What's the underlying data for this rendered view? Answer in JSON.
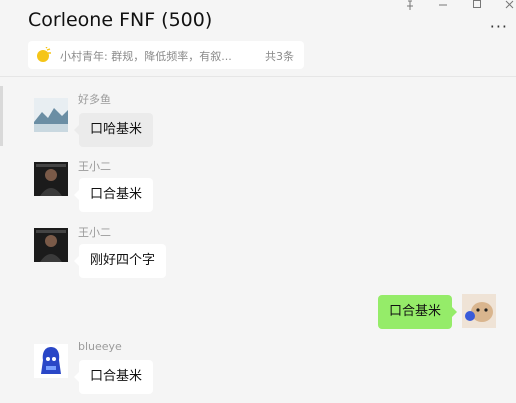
{
  "window": {
    "title": "Corleone FNF (500)",
    "controls": [
      "pin-icon",
      "minimize-icon",
      "maximize-icon",
      "close-icon"
    ],
    "more_icon": "more-icon"
  },
  "notice": {
    "icon": "announcement-icon",
    "text": "小村青年: 群规，降低频率，有叙...",
    "count": "共3条"
  },
  "messages": [
    {
      "sender": "好多鱼",
      "text": "口哈基米",
      "avatar": "landscape-avatar"
    },
    {
      "sender": "王小二",
      "text": "口合基米",
      "avatar": "photo-avatar"
    },
    {
      "sender": "王小二",
      "text": "刚好四个字",
      "avatar": "photo-avatar"
    },
    {
      "sender": "",
      "text": "口合基米",
      "avatar": "dog-avatar",
      "mine": true
    },
    {
      "sender": "blueeye",
      "text": "口合基米",
      "avatar": "blue-character-avatar"
    }
  ],
  "colors": {
    "background": "#f5f5f5",
    "bubble_mine": "#95ec69",
    "bubble_other": "#ffffff",
    "notice_icon": "#f5c518"
  }
}
